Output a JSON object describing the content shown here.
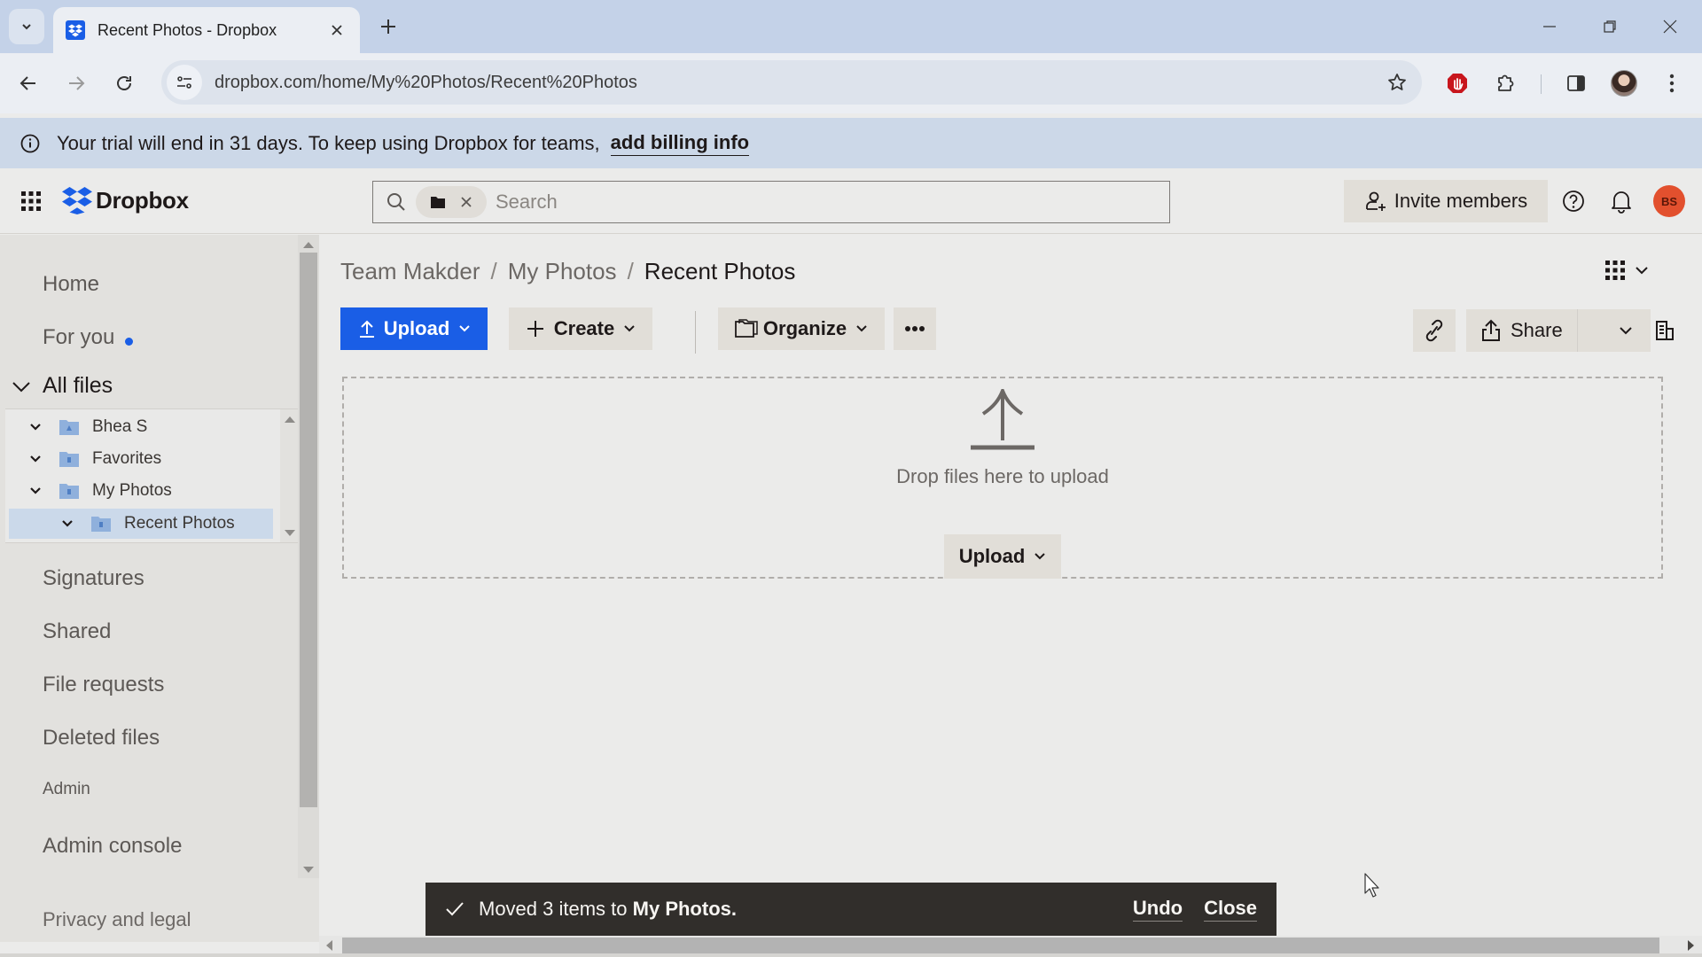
{
  "browser": {
    "tab_title": "Recent Photos - Dropbox",
    "url": "dropbox.com/home/My%20Photos/Recent%20Photos",
    "icons": [
      "tab-search-icon",
      "dropbox-favicon",
      "close-tab-icon",
      "new-tab-icon",
      "minimize-icon",
      "restore-icon",
      "close-window-icon",
      "back-icon",
      "forward-icon",
      "reload-icon",
      "site-info-icon",
      "bookmark-star-icon",
      "adblock-icon",
      "extensions-icon",
      "side-panel-icon",
      "profile-avatar",
      "menu-kebab-icon"
    ]
  },
  "banner": {
    "text": "Your trial will end in 31 days. To keep using Dropbox for teams,",
    "link": "add billing info"
  },
  "header": {
    "logo_text": "Dropbox",
    "search_placeholder": "Search",
    "invite_label": "Invite members",
    "avatar_initials": "BS",
    "avatar_color": "#e2502e"
  },
  "sidebar": {
    "nav_top": [
      {
        "label": "Home"
      },
      {
        "label": "For you",
        "has_dot": true
      }
    ],
    "all_files_label": "All files",
    "tree": [
      {
        "label": "Bhea S",
        "level": 0,
        "icon": "team-folder-icon"
      },
      {
        "label": "Favorites",
        "level": 0,
        "icon": "folder-icon"
      },
      {
        "label": "My Photos",
        "level": 0,
        "icon": "folder-icon"
      },
      {
        "label": "Recent Photos",
        "level": 1,
        "icon": "folder-icon",
        "selected": true
      }
    ],
    "nav_bottom": [
      {
        "label": "Signatures"
      },
      {
        "label": "Shared"
      },
      {
        "label": "File requests"
      },
      {
        "label": "Deleted files"
      }
    ],
    "admin_section_label": "Admin",
    "admin_console_label": "Admin console",
    "privacy_label": "Privacy and legal"
  },
  "main": {
    "breadcrumb": [
      "Team Makder",
      "My Photos",
      "Recent Photos"
    ],
    "actions": {
      "upload": "Upload",
      "create": "Create",
      "organize": "Organize",
      "share": "Share"
    },
    "dropzone": {
      "text": "Drop files here to upload",
      "upload_label": "Upload"
    }
  },
  "toast": {
    "text_prefix": "Moved 3 items to ",
    "text_bold": "My Photos.",
    "undo_label": "Undo",
    "close_label": "Close"
  },
  "colors": {
    "accent": "#1a5ee6",
    "banner_bg": "#ccd8e8",
    "toast_bg": "#312e2b"
  }
}
